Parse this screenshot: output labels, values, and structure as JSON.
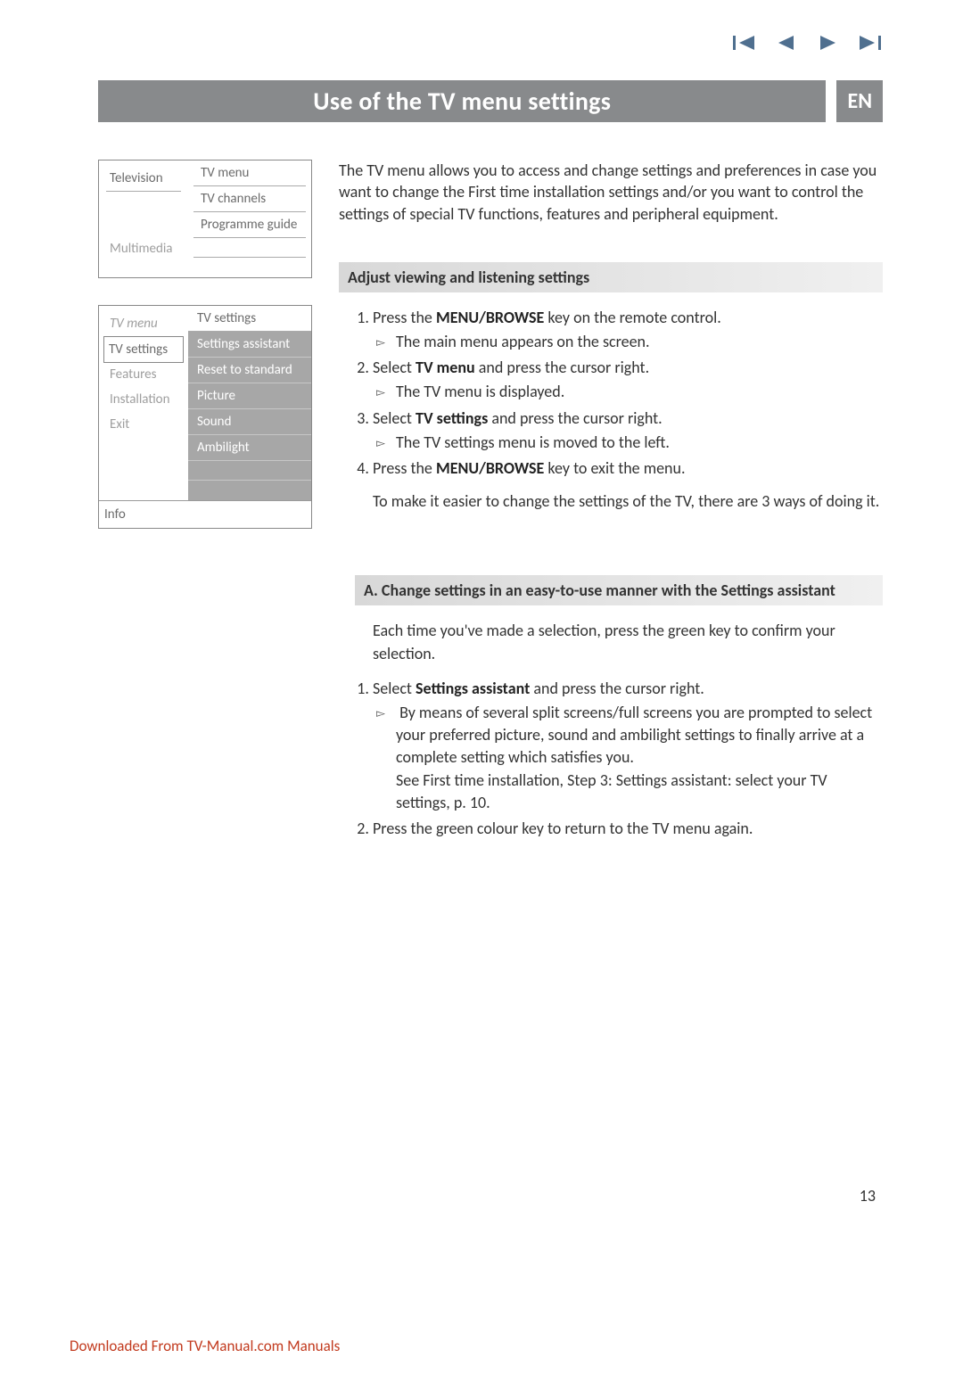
{
  "nav_icons": [
    "first-icon",
    "prev-icon",
    "next-icon",
    "last-icon"
  ],
  "title": "Use of the TV menu settings",
  "lang": "EN",
  "menu1": {
    "left": [
      "Television",
      "Multimedia"
    ],
    "right": [
      "TV menu",
      "TV channels",
      "Programme guide"
    ]
  },
  "menu2": {
    "left_header": "TV menu",
    "left_items": [
      "TV settings",
      "Features",
      "Installation",
      "Exit"
    ],
    "right_header": "TV settings",
    "right_items": [
      "Settings assistant",
      "Reset to standard",
      "Picture",
      "Sound",
      "Ambilight"
    ],
    "bottom": "Info"
  },
  "intro": "The TV menu allows you to access and change settings and preferences in case you want to change the First time installation settings and/or you want to control the settings of special TV functions, features and peripheral equipment.",
  "section1_header": "Adjust viewing and listening settings",
  "steps1": {
    "s1": "Press the ",
    "s1b": "MENU/BROWSE",
    "s1c": " key on the remote control.",
    "s1r": "The main menu appears on the screen.",
    "s2a": "Select ",
    "s2b": "TV menu",
    "s2c": " and press the cursor right.",
    "s2r": "The TV menu is displayed.",
    "s3a": "Select ",
    "s3b": "TV settings",
    "s3c": " and press the cursor right.",
    "s3r": "The TV settings menu is moved to the left.",
    "s4a": "Press the ",
    "s4b": "MENU/BROWSE",
    "s4c": " key to exit the menu."
  },
  "note1": "To make it easier to change the settings of the TV, there are 3 ways of doing it.",
  "section2_header": "A. Change settings in an easy-to-use manner with the Settings assistant",
  "section2_intro": "Each time you've made a selection, press the green key to confirm your selection.",
  "steps2": {
    "s1a": "Select ",
    "s1b": "Settings assistant",
    "s1c": " and press the cursor right.",
    "s1r1": "By means of several split screens/full screens you are prompted to select your preferred picture, sound and ambilight settings to finally arrive at a complete setting which satisfies you.",
    "s1r2": "See First time installation, Step 3: Settings assistant: select your TV settings, p. 10.",
    "s2": "Press the green colour key to return to the TV menu again."
  },
  "page_number": "13",
  "footer": "Downloaded From TV-Manual.com Manuals"
}
